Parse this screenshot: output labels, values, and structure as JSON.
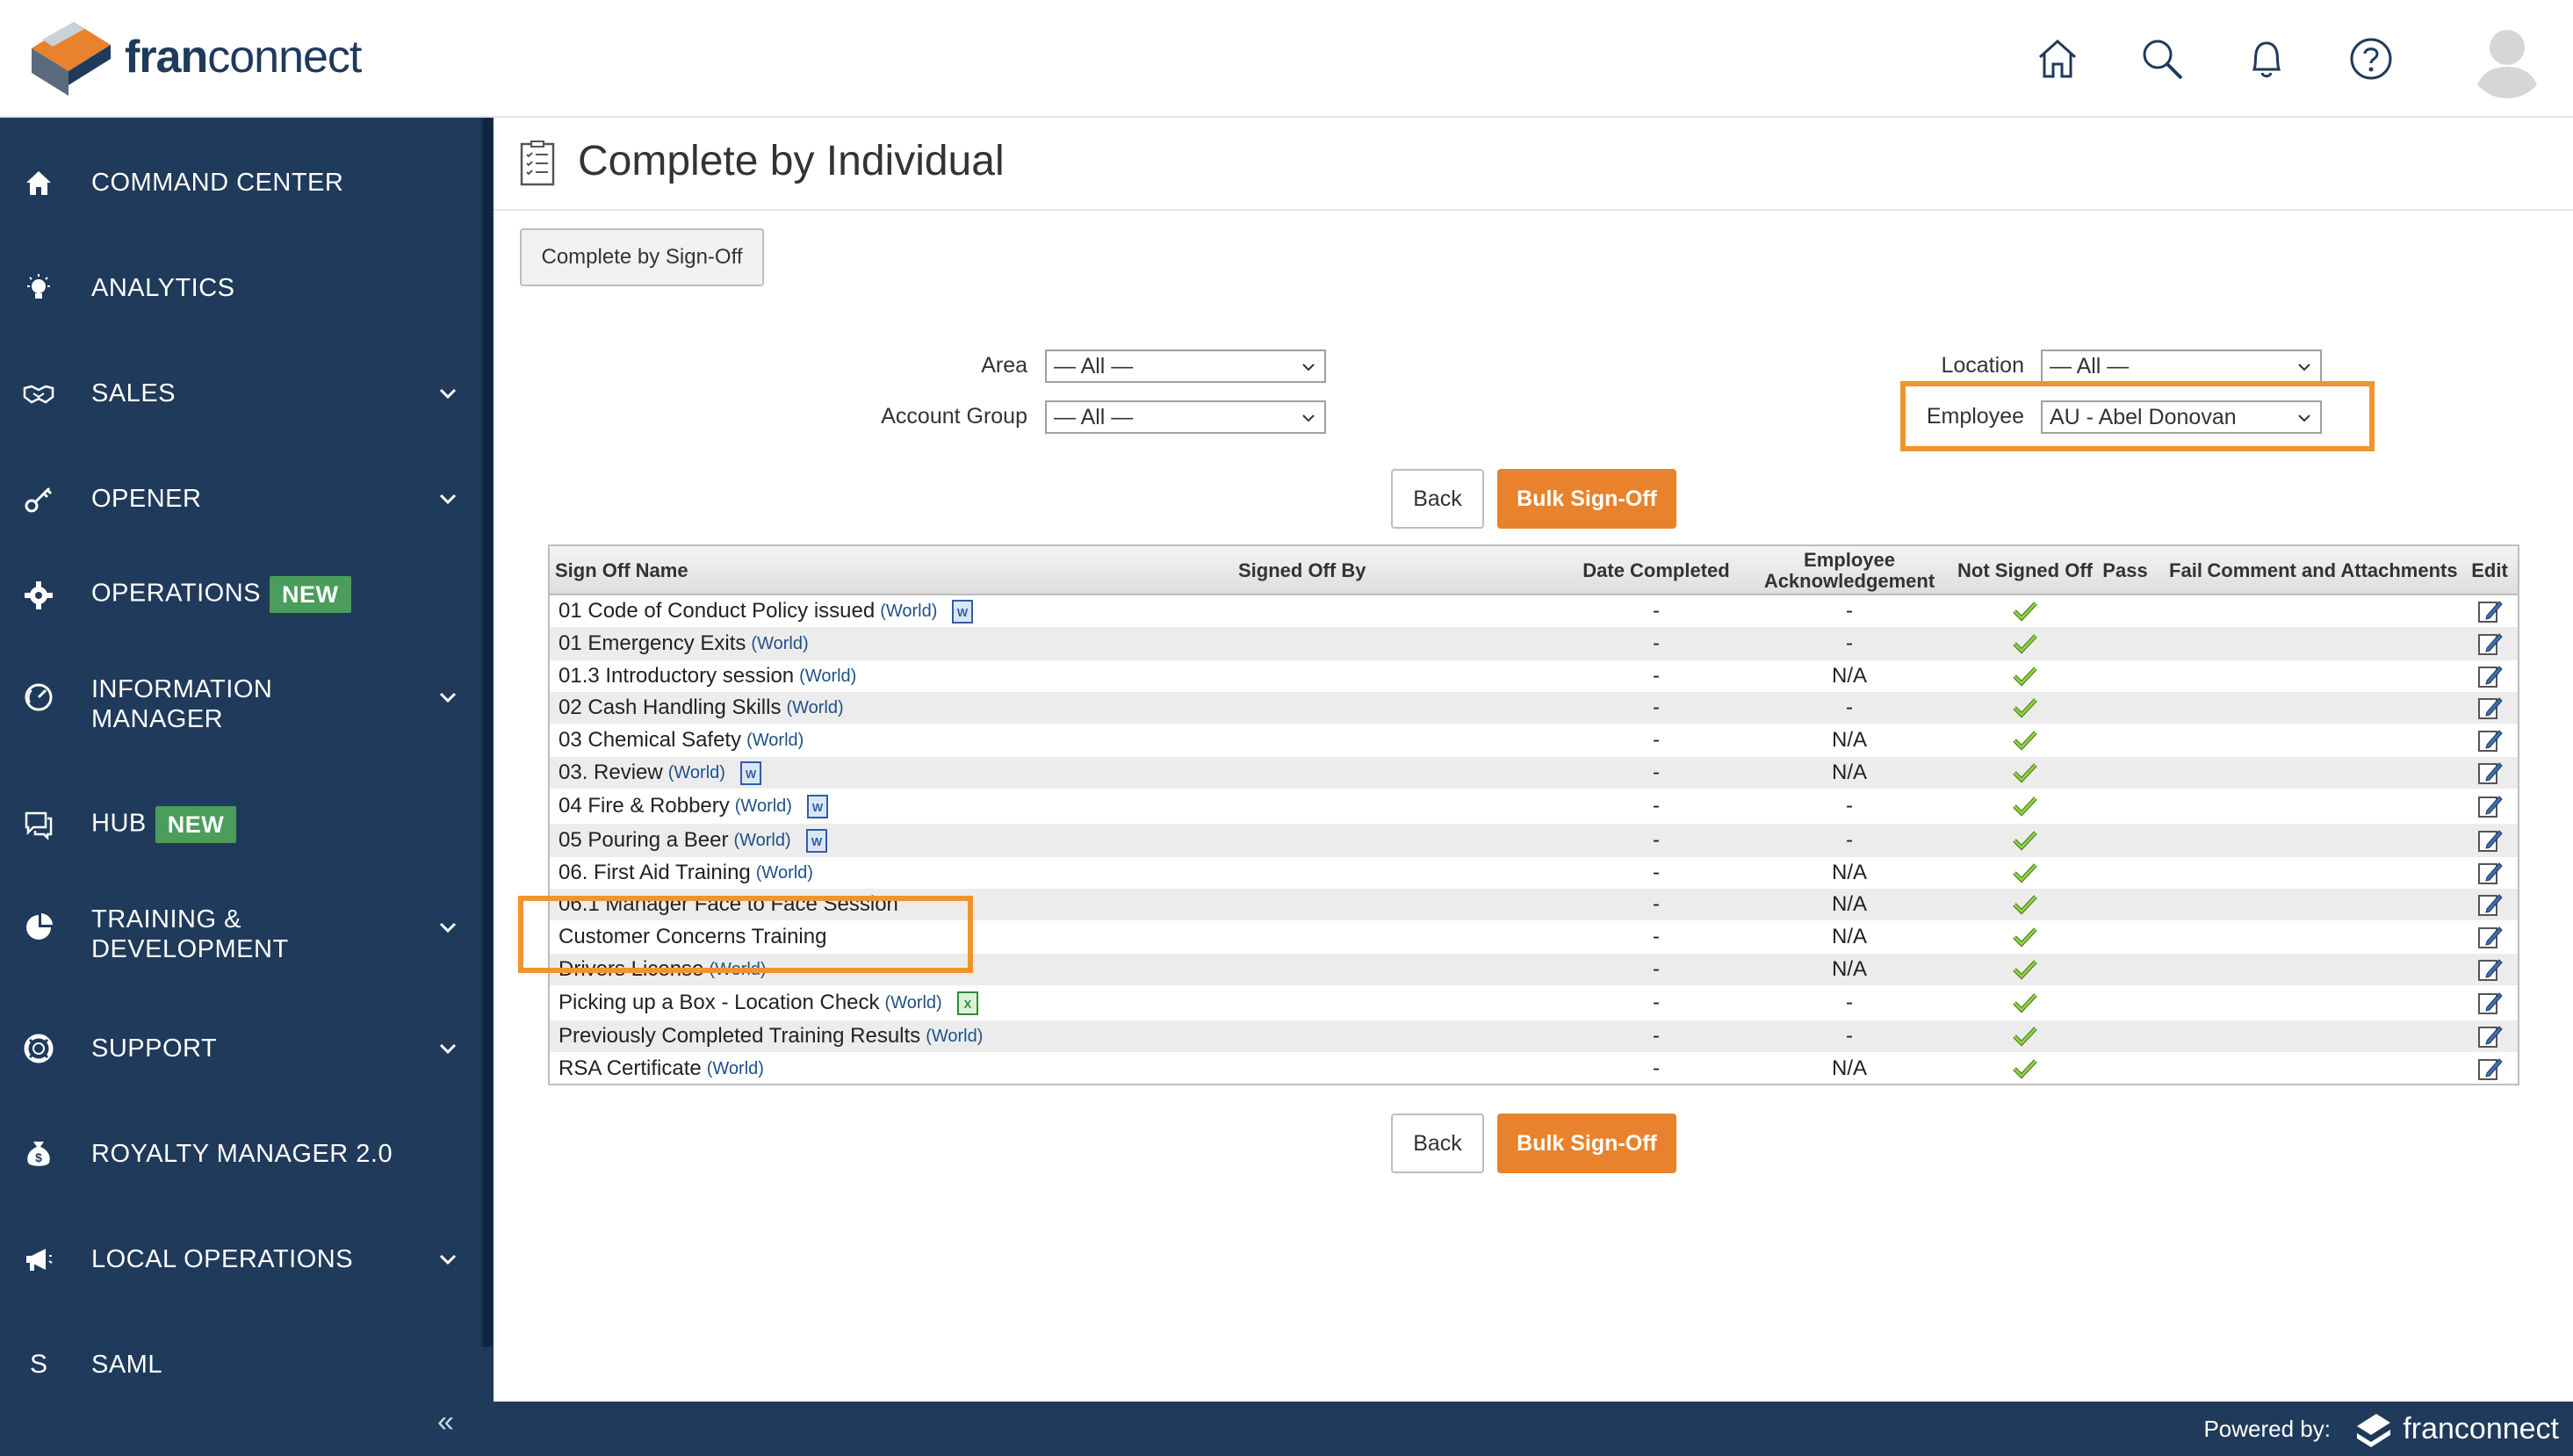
{
  "header": {
    "logo_text_bold": "fran",
    "logo_text_rest": "connect",
    "icons": [
      "home-icon",
      "search-icon",
      "bell-icon",
      "help-icon",
      "avatar"
    ]
  },
  "sidebar": {
    "items": [
      {
        "label": "COMMAND CENTER",
        "icon": "home-icon",
        "chevron": false,
        "badge": ""
      },
      {
        "label": "ANALYTICS",
        "icon": "lightbulb-icon",
        "chevron": false,
        "badge": ""
      },
      {
        "label": "SALES",
        "icon": "handshake-icon",
        "chevron": true,
        "badge": ""
      },
      {
        "label": "OPENER",
        "icon": "key-icon",
        "chevron": true,
        "badge": ""
      },
      {
        "label": "OPERATIONS",
        "icon": "gear-icon",
        "chevron": false,
        "badge": "NEW"
      },
      {
        "label": "INFORMATION",
        "label2": "MANAGER",
        "icon": "gauge-icon",
        "chevron": true,
        "badge": ""
      },
      {
        "label": "HUB",
        "icon": "chat-icon",
        "chevron": false,
        "badge": "NEW"
      },
      {
        "label": "TRAINING &",
        "label2": "DEVELOPMENT",
        "icon": "pie-icon",
        "chevron": true,
        "badge": ""
      },
      {
        "label": "SUPPORT",
        "icon": "lifebuoy-icon",
        "chevron": true,
        "badge": ""
      },
      {
        "label": "ROYALTY MANAGER 2.0",
        "icon": "moneybag-icon",
        "chevron": false,
        "badge": ""
      },
      {
        "label": "LOCAL OPERATIONS",
        "icon": "megaphone-icon",
        "chevron": true,
        "badge": ""
      },
      {
        "label": "SAML",
        "icon": "letter-s-icon",
        "chevron": false,
        "badge": ""
      }
    ],
    "collapse_glyph": "«"
  },
  "page": {
    "title": "Complete by Individual",
    "complete_by_signoff_label": "Complete by Sign-Off"
  },
  "filters": {
    "area_label": "Area",
    "area_value": "— All —",
    "account_group_label": "Account Group",
    "account_group_value": "— All —",
    "location_label": "Location",
    "location_value": "— All —",
    "employee_label": "Employee",
    "employee_value": "AU - Abel Donovan"
  },
  "actions": {
    "back_label": "Back",
    "bulk_label": "Bulk Sign-Off"
  },
  "table": {
    "headers": {
      "name": "Sign Off Name",
      "signed_by": "Signed Off By",
      "date": "Date Completed",
      "ack1": "Employee",
      "ack2": "Acknowledgement",
      "not_signed": "Not Signed Off",
      "pass": "Pass",
      "fail": "Fail",
      "comment": "Comment and Attachments",
      "edit": "Edit"
    },
    "rows": [
      {
        "name": "01 Code of Conduct Policy issued",
        "tag": "(World)",
        "doc": "word",
        "date": "-",
        "ack": "-"
      },
      {
        "name": "01 Emergency Exits",
        "tag": "(World)",
        "doc": "",
        "date": "-",
        "ack": "-"
      },
      {
        "name": "01.3 Introductory session",
        "tag": "(World)",
        "doc": "",
        "date": "-",
        "ack": "N/A"
      },
      {
        "name": "02 Cash Handling Skills",
        "tag": "(World)",
        "doc": "",
        "date": "-",
        "ack": "-"
      },
      {
        "name": "03 Chemical Safety",
        "tag": "(World)",
        "doc": "",
        "date": "-",
        "ack": "N/A"
      },
      {
        "name": "03. Review",
        "tag": "(World)",
        "doc": "word",
        "date": "-",
        "ack": "N/A"
      },
      {
        "name": "04 Fire & Robbery",
        "tag": "(World)",
        "doc": "word",
        "date": "-",
        "ack": "-"
      },
      {
        "name": "05 Pouring a Beer",
        "tag": "(World)",
        "doc": "word",
        "date": "-",
        "ack": "-"
      },
      {
        "name": "06. First Aid Training",
        "tag": "(World)",
        "doc": "",
        "date": "-",
        "ack": "N/A"
      },
      {
        "name": "06.1 Manager Face to Face Session",
        "tag": "",
        "doc": "",
        "date": "-",
        "ack": "N/A"
      },
      {
        "name": "Customer Concerns Training",
        "tag": "",
        "doc": "",
        "date": "-",
        "ack": "N/A"
      },
      {
        "name": "Drivers License",
        "tag": "(World)",
        "doc": "",
        "date": "-",
        "ack": "N/A"
      },
      {
        "name": "Picking up a Box - Location Check",
        "tag": "(World)",
        "doc": "excel",
        "date": "-",
        "ack": "-"
      },
      {
        "name": "Previously Completed Training Results",
        "tag": "(World)",
        "doc": "",
        "date": "-",
        "ack": "-"
      },
      {
        "name": "RSA Certificate",
        "tag": "(World)",
        "doc": "",
        "date": "-",
        "ack": "N/A"
      }
    ]
  },
  "footer": {
    "powered_by": "Powered by:",
    "brand": "franconnect"
  },
  "colors": {
    "sidebar_bg": "#1f3a5a",
    "accent_orange": "#e9822c",
    "badge_green": "#4a9d5b",
    "highlight_orange": "#f0952e"
  }
}
